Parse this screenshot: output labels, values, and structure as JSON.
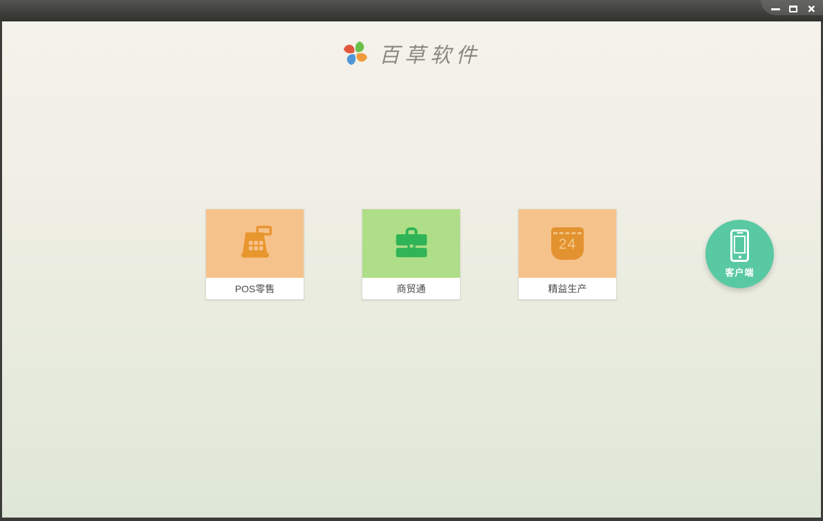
{
  "window": {
    "controls": {
      "minimize": "minimize",
      "maximize": "maximize",
      "close": "close",
      "close_glyph": "×"
    }
  },
  "header": {
    "app_title": "百草软件",
    "logo": "pinwheel-icon",
    "logo_petal_colors": [
      "#6cc04a",
      "#f09a3e",
      "#4f96d8",
      "#e2573d"
    ]
  },
  "products": [
    {
      "label": "POS零售",
      "icon": "cash-register-icon",
      "bg_color": "#f6c28b",
      "icon_color": "#e8962e"
    },
    {
      "label": "商贸通",
      "icon": "briefcase-icon",
      "bg_color": "#aede87",
      "icon_color": "#2fb457"
    },
    {
      "label": "精益生产",
      "icon": "calendar-icon",
      "bg_color": "#f6c28b",
      "icon_color": "#e2922f",
      "calendar_day": "24"
    }
  ],
  "client_button": {
    "label": "客户端",
    "icon": "smartphone-icon",
    "bg_color": "#58c9a3"
  },
  "colors": {
    "titlebar_dark": "#3a3a37",
    "titlebar_tab": "#5e5e5c",
    "content_bg_top": "#f4f2ea",
    "content_bg_bottom": "#dfe7d9",
    "card_label_text": "#4a4a4a",
    "app_title_text": "#89897f"
  }
}
